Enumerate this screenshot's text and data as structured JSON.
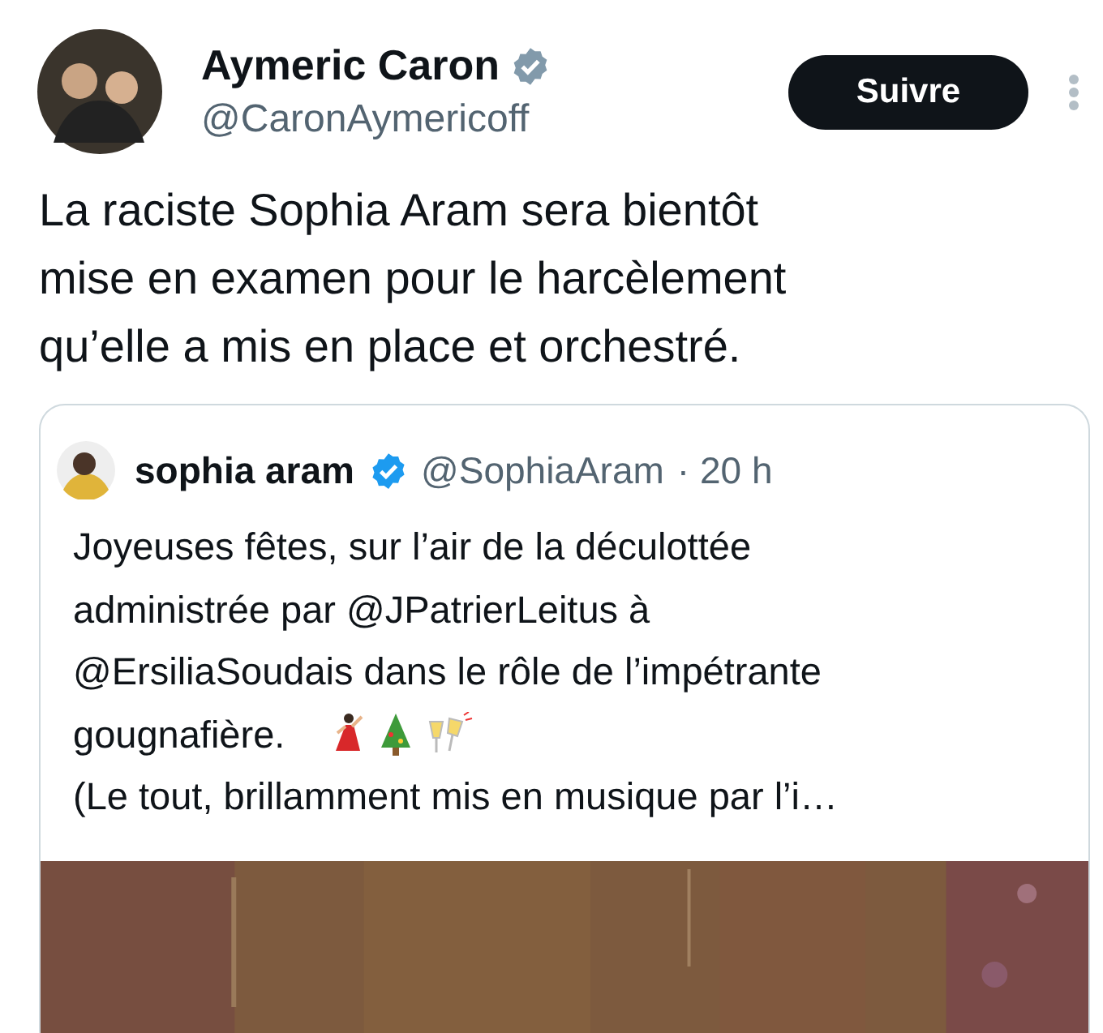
{
  "author": {
    "name": "Aymeric Caron",
    "handle": "@CaronAymericoff",
    "verified": true
  },
  "follow_button": "Suivre",
  "text": "La raciste Sophia Aram sera bientôt\nmise en examen pour le harcèlement\nqu’elle a mis en place et orchestré.",
  "quote": {
    "name": "sophia aram",
    "verified": true,
    "handle": "@SophiaAram",
    "time": "· 20 h",
    "text_lines": [
      "Joyeuses fêtes, sur l’air de la déculottée",
      "administrée par @JPatrierLeitus à",
      "@ErsiliaSoudais dans le rôle de l’impétrante",
      "gougnafière."
    ],
    "emojis": [
      {
        "kind": "dancer"
      },
      {
        "kind": "tree"
      },
      {
        "kind": "glasses"
      }
    ],
    "last_line": "(Le tout, brillamment mis en musique par l’i…"
  }
}
